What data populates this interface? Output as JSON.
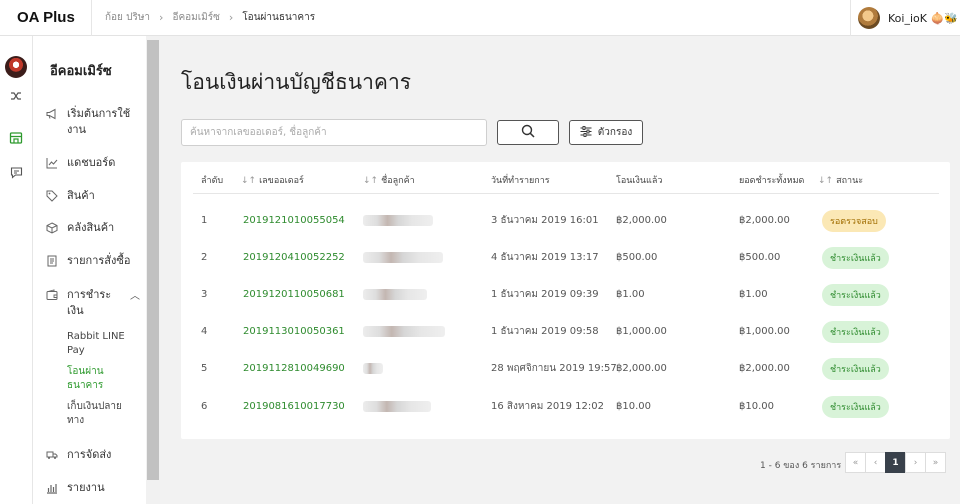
{
  "app": {
    "logo": "OA Plus"
  },
  "breadcrumb": {
    "items": [
      "ก้อย ปริษา",
      "อีคอมเมิร์ซ",
      "โอนผ่านธนาคาร"
    ]
  },
  "user": {
    "name": "Koi_ioK 🧅🐝"
  },
  "sidebar": {
    "title": "อีคอมเมิร์ซ",
    "items": [
      {
        "label": "เริ่มต้นการใช้งาน",
        "icon": "megaphone-icon"
      },
      {
        "label": "แดชบอร์ด",
        "icon": "chart-line-icon"
      },
      {
        "label": "สินค้า",
        "icon": "tag-icon"
      },
      {
        "label": "คลังสินค้า",
        "icon": "box-icon"
      },
      {
        "label": "รายการสั่งซื้อ",
        "icon": "receipt-icon"
      },
      {
        "label": "การชำระเงิน",
        "icon": "wallet-icon"
      },
      {
        "label": "การจัดส่ง",
        "icon": "truck-icon"
      },
      {
        "label": "รายงาน",
        "icon": "bar-chart-icon"
      }
    ],
    "payment_sub": [
      "Rabbit LINE Pay",
      "โอนผ่านธนาคาร",
      "เก็บเงินปลายทาง"
    ]
  },
  "main": {
    "title": "โอนเงินผ่านบัญชีธนาคาร",
    "search_placeholder": "ค้นหาจากเลขออเดอร์, ชื่อลูกค้า",
    "filter_label": "ตัวกรอง"
  },
  "table": {
    "headers": {
      "index": "ลำดับ",
      "order": "เลขออเดอร์",
      "customer": "ชื่อลูกค้า",
      "date": "วันที่ทำรายการ",
      "transferred": "โอนเงินแล้ว",
      "total": "ยอดชำระทั้งหมด",
      "status": "สถานะ"
    },
    "rows": [
      {
        "index": "1",
        "order": "2019121010055054",
        "date": "3 ธันวาคม 2019 16:01",
        "transferred": "฿2,000.00",
        "total": "฿2,000.00",
        "status": "รอตรวจสอบ",
        "status_type": "pending"
      },
      {
        "index": "2",
        "order": "2019120410052252",
        "date": "4 ธันวาคม 2019 13:17",
        "transferred": "฿500.00",
        "total": "฿500.00",
        "status": "ชำระเงินแล้ว",
        "status_type": "paid"
      },
      {
        "index": "3",
        "order": "2019120110050681",
        "date": "1 ธันวาคม 2019 09:39",
        "transferred": "฿1.00",
        "total": "฿1.00",
        "status": "ชำระเงินแล้ว",
        "status_type": "paid"
      },
      {
        "index": "4",
        "order": "2019113010050361",
        "date": "1 ธันวาคม 2019 09:58",
        "transferred": "฿1,000.00",
        "total": "฿1,000.00",
        "status": "ชำระเงินแล้ว",
        "status_type": "paid"
      },
      {
        "index": "5",
        "order": "2019112810049690",
        "date": "28 พฤศจิกายน 2019 19:57",
        "transferred": "฿2,000.00",
        "total": "฿2,000.00",
        "status": "ชำระเงินแล้ว",
        "status_type": "paid"
      },
      {
        "index": "6",
        "order": "2019081610017730",
        "date": "16 สิงหาคม 2019 12:02",
        "transferred": "฿10.00",
        "total": "฿10.00",
        "status": "ชำระเงินแล้ว",
        "status_type": "paid"
      }
    ]
  },
  "pagination": {
    "info": "1 - 6 ของ 6 รายการ",
    "current": "1"
  }
}
